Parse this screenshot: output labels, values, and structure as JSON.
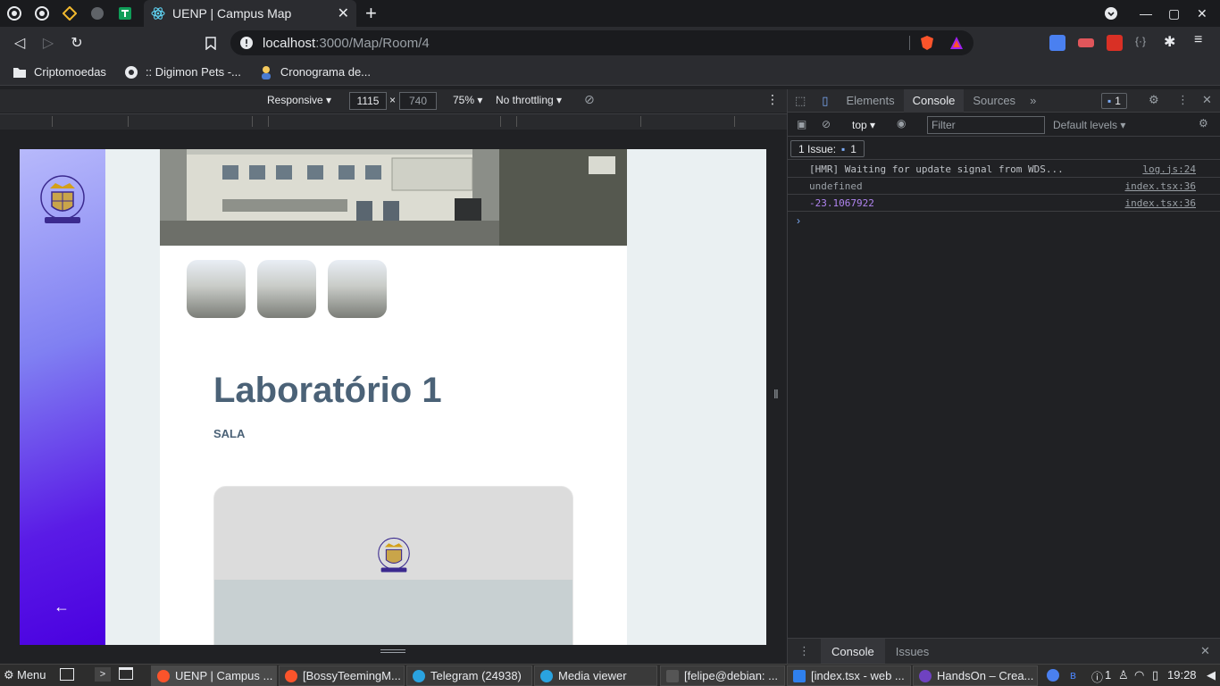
{
  "browser": {
    "active_tab_title": "UENP | Campus Map",
    "url_host": "localhost",
    "url_path": ":3000/Map/Room/4",
    "bookmarks": [
      "Criptomoedas",
      ":: Digimon Pets -...",
      "Cronograma de..."
    ]
  },
  "device_toolbar": {
    "mode": "Responsive ▾",
    "width": "1115",
    "height": "740",
    "zoom": "75% ▾",
    "throttling": "No throttling ▾"
  },
  "page": {
    "room_title": "Laboratório 1",
    "room_type": "SALA",
    "back_icon": "←"
  },
  "devtools": {
    "tabs": [
      "Elements",
      "Console",
      "Sources"
    ],
    "active_tab": "Console",
    "issues_count": "1",
    "context": "top ▾",
    "filter_placeholder": "Filter",
    "levels": "Default levels ▾",
    "issue_label": "1 Issue:",
    "issue_badge_count": "1",
    "console_rows": [
      {
        "message": "[HMR] Waiting for update signal from WDS...",
        "source": "log.js:24",
        "color": "#bdc1c6"
      },
      {
        "message": "undefined",
        "source": "index.tsx:36",
        "color": "#9aa0a6"
      },
      {
        "message": "-23.1067922",
        "source": "index.tsx:36",
        "color": "#b084f0"
      }
    ],
    "drawer_tabs": [
      "Console",
      "Issues"
    ]
  },
  "taskbar": {
    "menu": "Menu",
    "tasks": [
      {
        "label": "UENP | Campus ...",
        "color": "#fb542b"
      },
      {
        "label": "[BossyTeemingM...",
        "color": "#fb542b"
      },
      {
        "label": "Telegram (24938)",
        "color": "#2aa3e0"
      },
      {
        "label": "Media viewer",
        "color": "#2aa3e0"
      },
      {
        "label": "[felipe@debian: ...",
        "color": "#555555"
      },
      {
        "label": "[index.tsx - web ...",
        "color": "#2f80ed"
      },
      {
        "label": "HandsOn – Crea...",
        "color": "#6f42c1"
      }
    ],
    "notif_count": "1",
    "clock": "19:28"
  },
  "colors": {
    "accent": "#4a00e0",
    "title_text": "#4b6277"
  }
}
